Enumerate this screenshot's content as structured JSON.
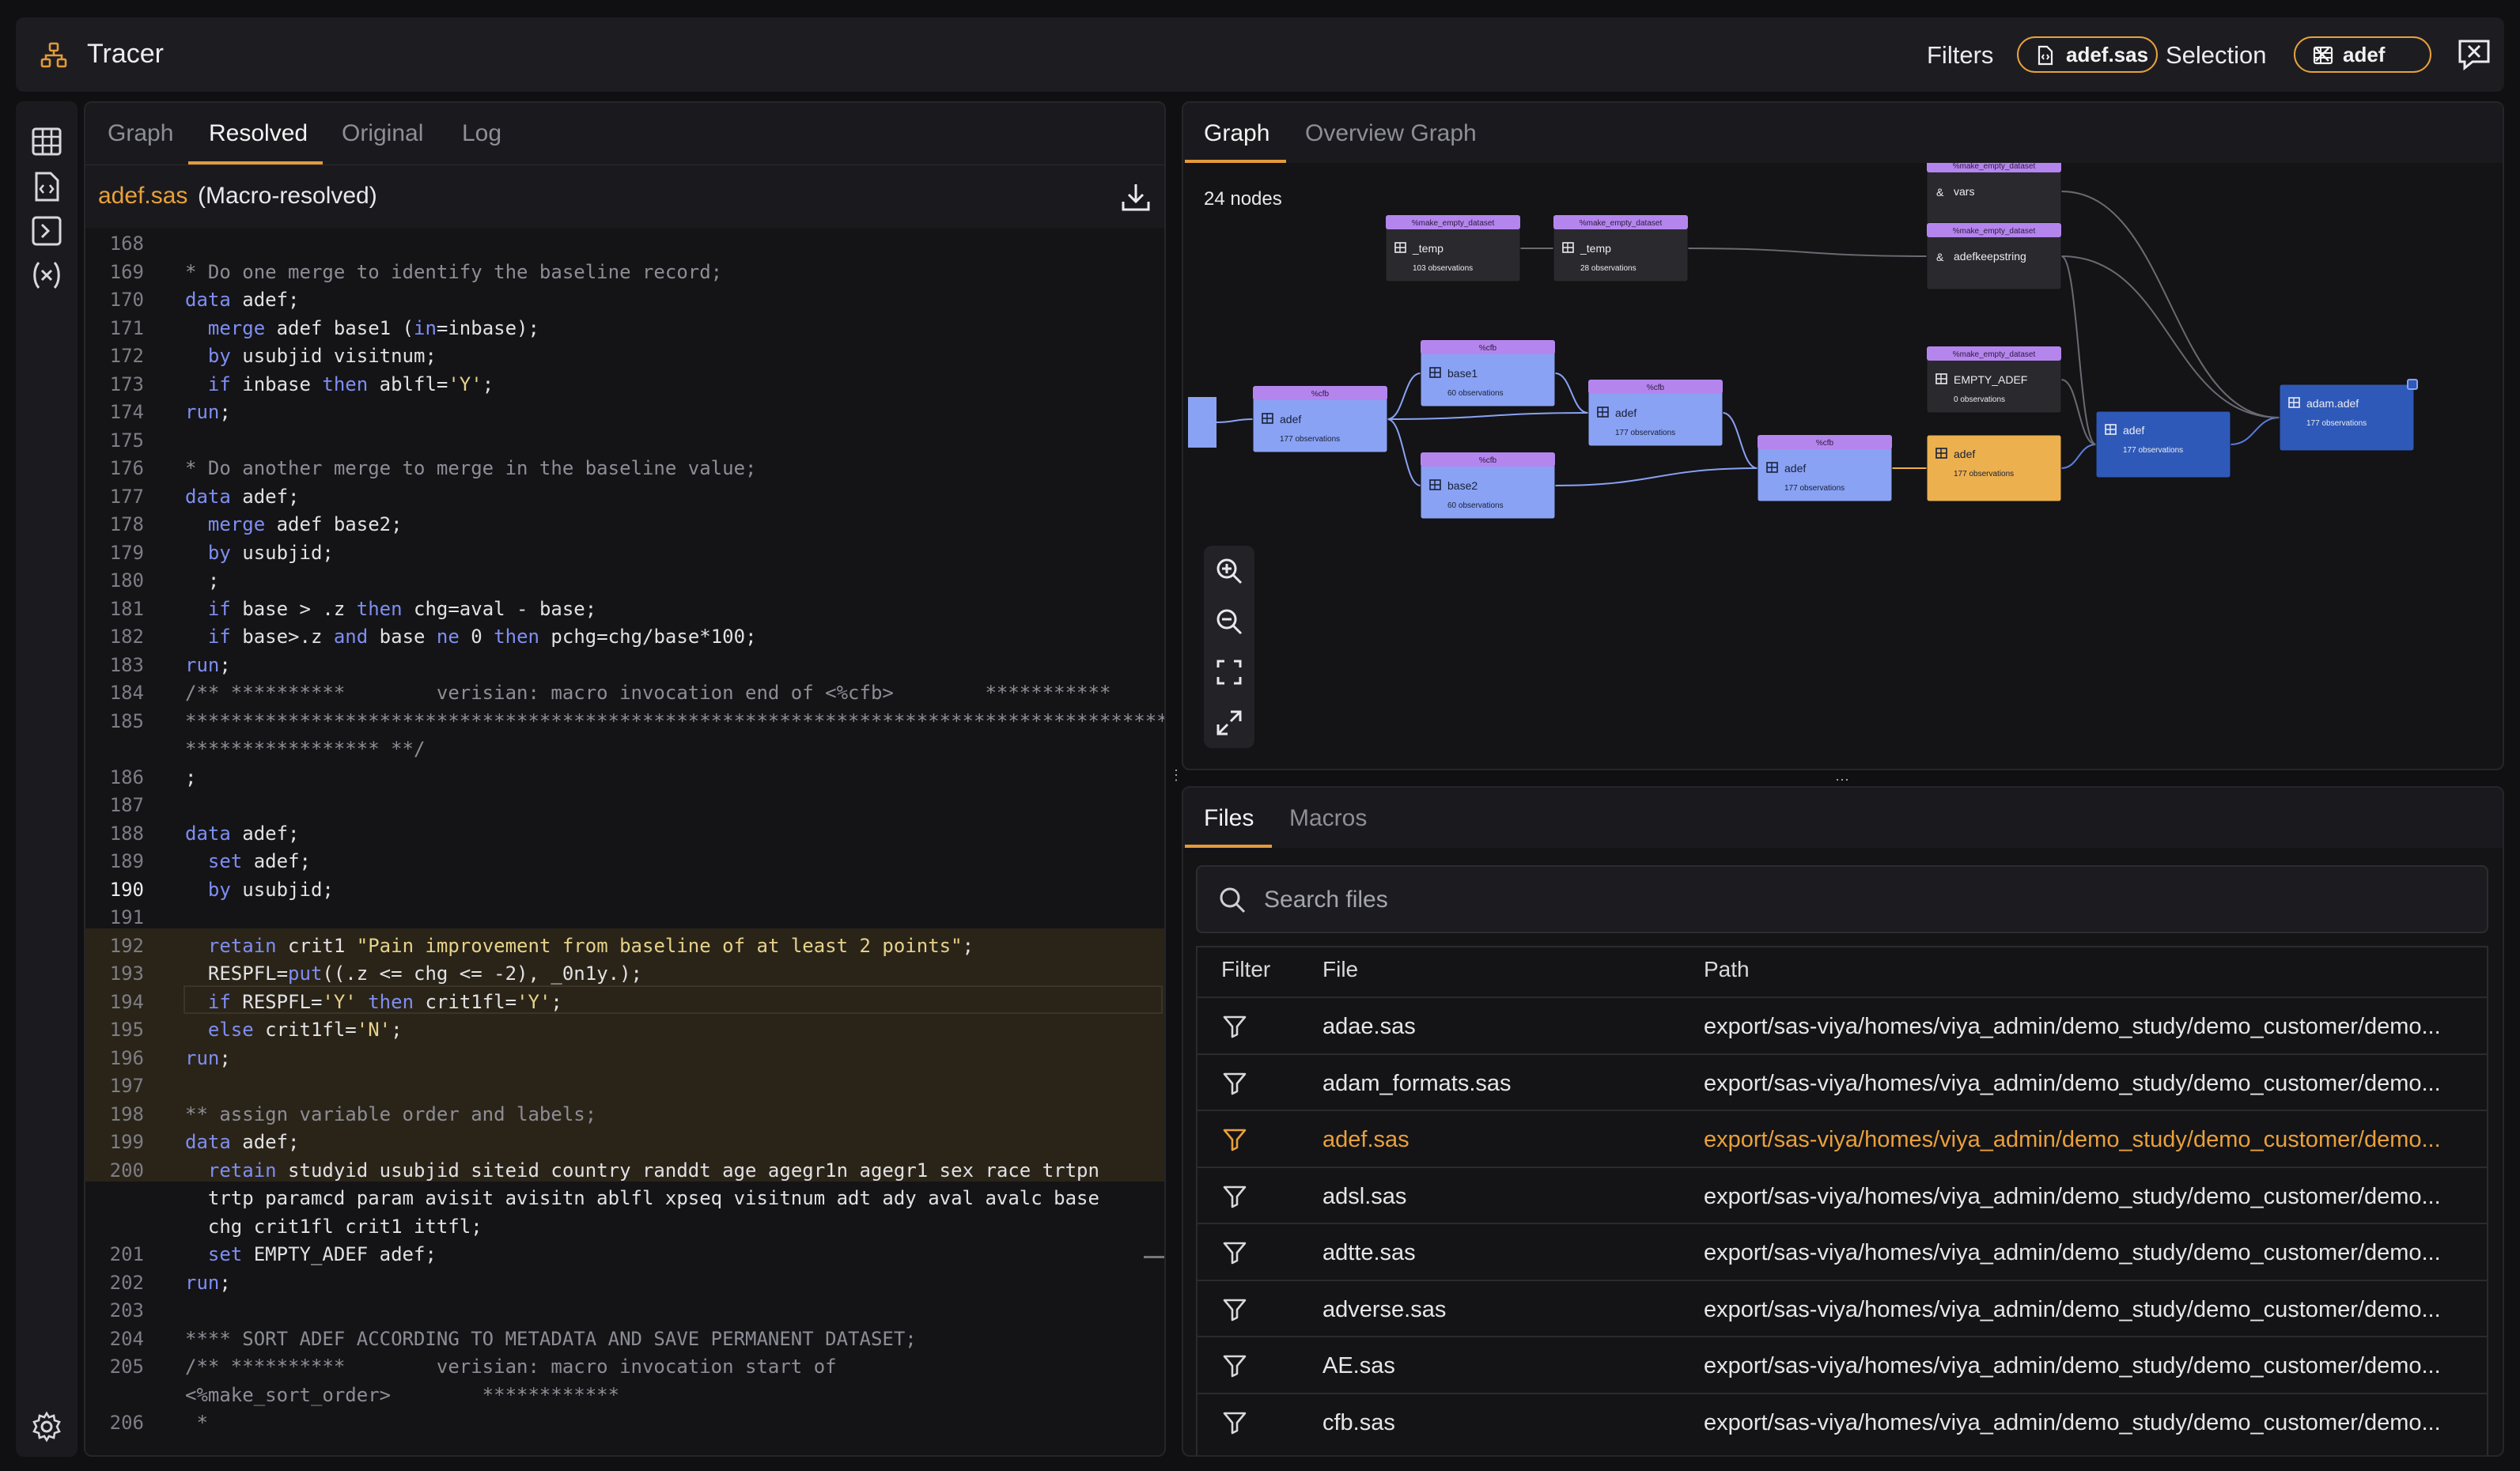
{
  "app": {
    "title": "Tracer"
  },
  "header": {
    "filters_label": "Filters",
    "filter_chip": "adef.sas",
    "selection_label": "Selection",
    "selection_chip": "adef"
  },
  "code_panel": {
    "tabs": [
      "Graph",
      "Resolved",
      "Original",
      "Log"
    ],
    "active_tab": "Resolved",
    "file_name": "adef.sas",
    "file_desc": "(Macro-resolved)",
    "line_numbers": [
      "168",
      "169",
      "170",
      "171",
      "172",
      "173",
      "174",
      "175",
      "176",
      "177",
      "178",
      "179",
      "180",
      "181",
      "182",
      "183",
      "184",
      "185",
      "",
      "186",
      "187",
      "188",
      "189",
      "190",
      "191",
      "192",
      "193",
      "194",
      "195",
      "196",
      "197",
      "198",
      "199",
      "200",
      "",
      "",
      "201",
      "202",
      "203",
      "204",
      "205",
      "",
      "206"
    ],
    "lines": [
      "",
      "* Do one merge to identify the baseline record;",
      "data adef;",
      "  merge adef base1 (in=inbase);",
      "  by usubjid visitnum;",
      "  if inbase then ablfl='Y';",
      "run;",
      "",
      "* Do another merge to merge in the baseline value;",
      "data adef;",
      "  merge adef base2;",
      "  by usubjid;",
      "  ;",
      "  if base > .z then chg=aval - base;",
      "  if base>.z and base ne 0 then pchg=chg/base*100;",
      "run;",
      "/** **********        verisian: macro invocation end of <%cfb>        ***********",
      "**************************************************************************************",
      "***************** **/",
      ";",
      "",
      "data adef;",
      "  set adef;",
      "  by usubjid;",
      "",
      "  retain crit1 \"Pain improvement from baseline of at least 2 points\";",
      "  RESPFL=put((.z <= chg <= -2), _0n1y.);",
      "  if RESPFL='Y' then crit1fl='Y';",
      "  else crit1fl='N';",
      "run;",
      "",
      "** assign variable order and labels;",
      "data adef;",
      "  retain studyid usubjid siteid country randdt age agegr1n agegr1 sex race trtpn",
      "  trtp paramcd param avisit avisitn ablfl xpseq visitnum adt ady aval avalc base",
      "  chg crit1fl crit1 ittfl;",
      "  set EMPTY_ADEF adef;",
      "run;",
      "",
      "**** SORT ADEF ACCORDING TO METADATA AND SAVE PERMANENT DATASET;",
      "/** **********        verisian: macro invocation start of",
      "<%make_sort_order>        ************",
      " *"
    ]
  },
  "graph_panel": {
    "tabs": [
      "Graph",
      "Overview Graph"
    ],
    "active_tab": "Graph",
    "node_count": "24 nodes",
    "nodes": [
      {
        "id": "n_vars",
        "macro": "%make_empty_dataset",
        "name": "vars",
        "obs": "",
        "color": "#2a2a2e",
        "tag": "#b585ee",
        "icon": "&"
      },
      {
        "id": "n_temp1",
        "macro": "%make_empty_dataset",
        "name": "_temp",
        "obs": "103 observations",
        "color": "#2a2a2e",
        "tag": "#b585ee",
        "icon": "file"
      },
      {
        "id": "n_temp2",
        "macro": "%make_empty_dataset",
        "name": "_temp",
        "obs": "28 observations",
        "color": "#2a2a2e",
        "tag": "#b585ee",
        "icon": "grid"
      },
      {
        "id": "n_keep",
        "macro": "%make_empty_dataset",
        "name": "adefkeepstring",
        "obs": "",
        "color": "#2a2a2e",
        "tag": "#b585ee",
        "icon": "&"
      },
      {
        "id": "n_empty",
        "macro": "%make_empty_dataset",
        "name": "EMPTY_ADEF",
        "obs": "0 observations",
        "color": "#2a2a2e",
        "tag": "#b585ee",
        "icon": "grid"
      },
      {
        "id": "n_adef1",
        "macro": "%cfb",
        "name": "adef",
        "obs": "177 observations",
        "color": "#8aa2f3",
        "tag": "#b585ee",
        "icon": "grid"
      },
      {
        "id": "n_base1",
        "macro": "%cfb",
        "name": "base1",
        "obs": "60 observations",
        "color": "#8aa2f3",
        "tag": "#b585ee",
        "icon": "grid"
      },
      {
        "id": "n_base2",
        "macro": "%cfb",
        "name": "base2",
        "obs": "60 observations",
        "color": "#8aa2f3",
        "tag": "#b585ee",
        "icon": "grid"
      },
      {
        "id": "n_adef2",
        "macro": "%cfb",
        "name": "adef",
        "obs": "177 observations",
        "color": "#8aa2f3",
        "tag": "#b585ee",
        "icon": "grid"
      },
      {
        "id": "n_adef3",
        "macro": "%cfb",
        "name": "adef",
        "obs": "177 observations",
        "color": "#8aa2f3",
        "tag": "#b585ee",
        "icon": "grid"
      },
      {
        "id": "n_adef4",
        "macro": "",
        "name": "adef",
        "obs": "177 observations",
        "color": "#ecb04e",
        "tag": "",
        "icon": "grid"
      },
      {
        "id": "n_adef5",
        "macro": "",
        "name": "adef",
        "obs": "177 observations",
        "color": "#2f59b8",
        "tag": "",
        "icon": "grid"
      },
      {
        "id": "n_adam",
        "macro": "",
        "name": "adam.adef",
        "obs": "177 observations",
        "color": "#2f59b8",
        "tag": "",
        "icon": "grid"
      }
    ]
  },
  "files_panel": {
    "tabs": [
      "Files",
      "Macros"
    ],
    "active_tab": "Files",
    "search_placeholder": "Search files",
    "columns": [
      "Filter",
      "File",
      "Path"
    ],
    "rows": [
      {
        "file": "adae.sas",
        "path": "export/sas-viya/homes/viya_admin/demo_study/demo_customer/demo..."
      },
      {
        "file": "adam_formats.sas",
        "path": "export/sas-viya/homes/viya_admin/demo_study/demo_customer/demo..."
      },
      {
        "file": "adef.sas",
        "path": "export/sas-viya/homes/viya_admin/demo_study/demo_customer/demo...",
        "active": true
      },
      {
        "file": "adsl.sas",
        "path": "export/sas-viya/homes/viya_admin/demo_study/demo_customer/demo..."
      },
      {
        "file": "adtte.sas",
        "path": "export/sas-viya/homes/viya_admin/demo_study/demo_customer/demo..."
      },
      {
        "file": "adverse.sas",
        "path": "export/sas-viya/homes/viya_admin/demo_study/demo_customer/demo..."
      },
      {
        "file": "AE.sas",
        "path": "export/sas-viya/homes/viya_admin/demo_study/demo_customer/demo..."
      },
      {
        "file": "cfb.sas",
        "path": "export/sas-viya/homes/viya_admin/demo_study/demo_customer/demo..."
      }
    ]
  },
  "colors": {
    "accent": "#e49a3a",
    "highlight_bg": "#2a2418",
    "keyword": "#7f8ef2",
    "string": "#e6d28a"
  }
}
